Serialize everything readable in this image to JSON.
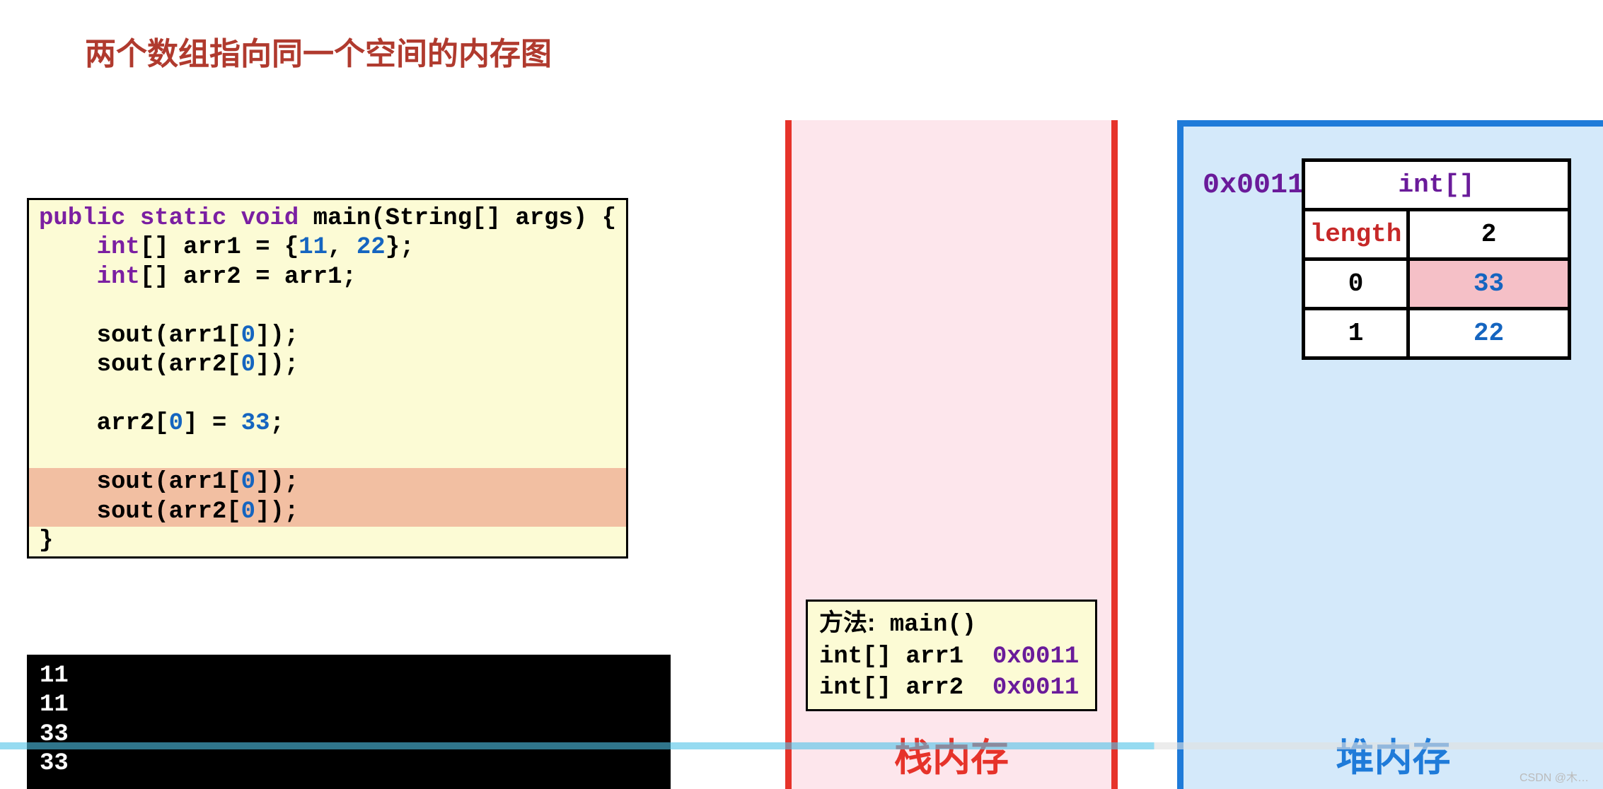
{
  "title": "两个数组指向同一个空间的内存图",
  "code": {
    "sig_kw": "public static void",
    "sig_rest": " main(String[] args) {",
    "int_kw": "int",
    "arr1_decl_rest": "[] arr1 = {",
    "arr1_v1": "11",
    "arr1_comma": ", ",
    "arr1_v2": "22",
    "arr1_end": "};",
    "arr2_decl_rest": "[] arr2 = arr1;",
    "sout1a": "sout(arr1[",
    "zero": "0",
    "sout1b": "]);",
    "sout2a": "sout(arr2[",
    "assign_a": "arr2[",
    "assign_b": "] = ",
    "assign_v": "33",
    "assign_c": ";",
    "close": "}"
  },
  "console": {
    "l1": "11",
    "l2": "11",
    "l3": "33",
    "l4": "33"
  },
  "stack": {
    "method_label": "方法:",
    "method_name": " main()",
    "var1_type": "int[] arr1  ",
    "var1_addr": "0x0011",
    "var2_type": "int[] arr2  ",
    "var2_addr": "0x0011",
    "title": "栈内存"
  },
  "heap": {
    "addr": "0x0011",
    "type": "int[]",
    "length_label": "length",
    "length_val": "2",
    "idx0": "0",
    "val0": "33",
    "idx1": "1",
    "val1": "22",
    "title": "堆内存"
  },
  "watermark": "CSDN @木…"
}
